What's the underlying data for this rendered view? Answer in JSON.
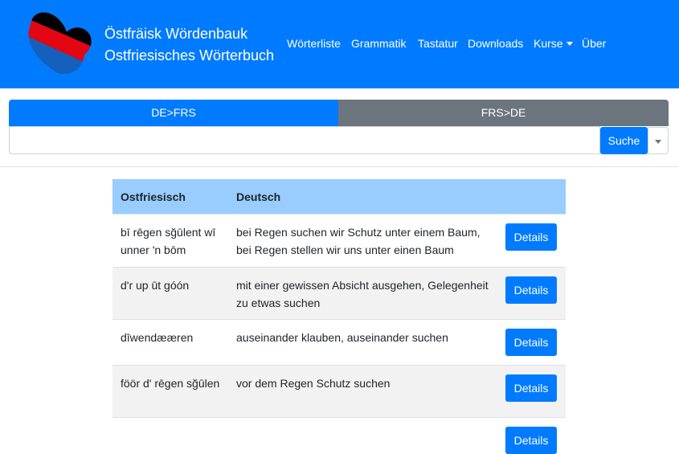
{
  "brand": {
    "line1": "Östfräisk Wördenbauk",
    "line2": "Ostfriesisches Wörterbuch",
    "logo_colors": [
      "#000000",
      "#e30613",
      "#1560bd"
    ]
  },
  "nav": {
    "items": [
      {
        "label": "Wörterliste"
      },
      {
        "label": "Grammatik"
      },
      {
        "label": "Tastatur"
      },
      {
        "label": "Downloads"
      },
      {
        "label": "Kurse"
      },
      {
        "label": "Über"
      }
    ]
  },
  "direction_tabs": {
    "de_frs": "DE>FRS",
    "frs_de": "FRS>DE"
  },
  "search": {
    "value": "",
    "button_label": "Suche"
  },
  "table": {
    "headers": [
      "Ostfriesisch",
      "Deutsch"
    ],
    "rows": [
      {
        "frs": "bī rēgen sğūlent wī unner 'n bōm",
        "de": "bei Regen suchen wir Schutz unter einem Baum, bei Regen stellen wir uns unter einen Baum",
        "button": "Details"
      },
      {
        "frs": "d'r up ūt góón",
        "de": "mit einer gewissen Absicht ausgehen, Gelegenheit zu etwas suchen",
        "button": "Details"
      },
      {
        "frs": "dīwendææren",
        "de": "auseinander klauben, auseinander suchen",
        "button": "Details"
      },
      {
        "frs": "föör d' rēgen sğūlen",
        "de": "vor dem Regen Schutz suchen",
        "button": "Details"
      },
      {
        "frs": "",
        "de": "",
        "button": "Details"
      }
    ]
  },
  "colors": {
    "primary": "#007bff",
    "secondary": "#6c757d",
    "table_header": "#99ccff",
    "row_alt": "#f2f2f2"
  }
}
